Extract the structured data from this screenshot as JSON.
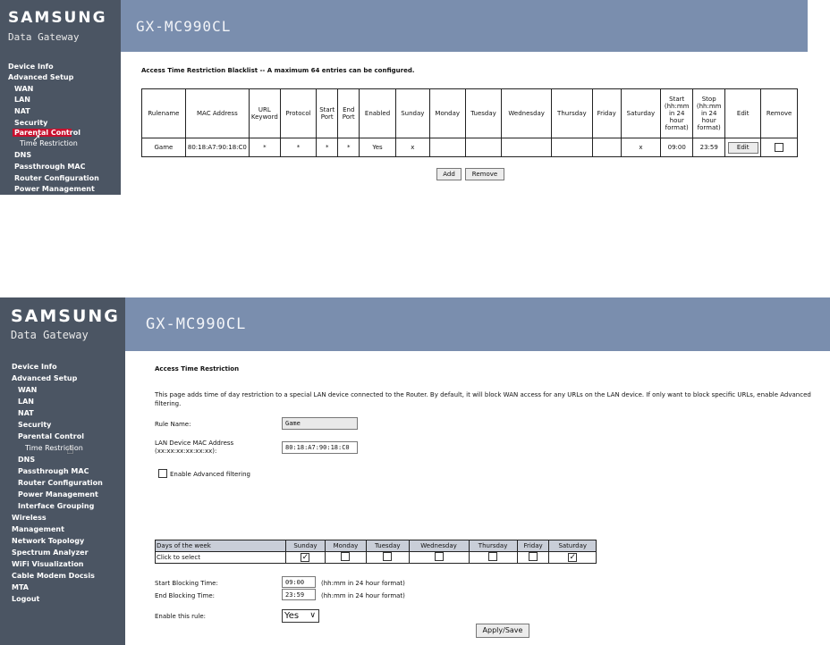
{
  "brand": {
    "name": "SAMSUNG",
    "subtitle": "Data Gateway",
    "model": "GX-MC990CL"
  },
  "shot1": {
    "sidebar": [
      "Device Info",
      "Advanced Setup",
      "WAN",
      "LAN",
      "NAT",
      "Security",
      "Parental Control",
      "Time Restriction",
      "DNS",
      "Passthrough MAC",
      "Router Configuration",
      "Power Management"
    ],
    "active_item": "Parental Control",
    "title": "Access Time Restriction Blacklist -- A maximum 64 entries can be configured.",
    "table": {
      "headers": [
        "Rulename",
        "MAC Address",
        "URL Keyword",
        "Protocol",
        "Start Port",
        "End Port",
        "Enabled",
        "Sunday",
        "Monday",
        "Tuesday",
        "Wednesday",
        "Thursday",
        "Friday",
        "Saturday",
        "Start (hh:mm in 24 hour format)",
        "Stop (hh:mm in 24 hour format)",
        "Edit",
        "Remove"
      ],
      "row": {
        "rulename": "Game",
        "mac": "80:18:A7:90:18:C0",
        "url": "*",
        "protocol": "*",
        "start_port": "*",
        "end_port": "*",
        "enabled": "Yes",
        "sunday": "x",
        "monday": "",
        "tuesday": "",
        "wednesday": "",
        "thursday": "",
        "friday": "",
        "saturday": "x",
        "start": "09:00",
        "stop": "23:59",
        "edit_label": "Edit",
        "remove_checked": false
      }
    },
    "buttons": {
      "add": "Add",
      "remove": "Remove"
    }
  },
  "shot2": {
    "sidebar": [
      "Device Info",
      "Advanced Setup",
      "WAN",
      "LAN",
      "NAT",
      "Security",
      "Parental Control",
      "Time Restriction",
      "DNS",
      "Passthrough MAC",
      "Router Configuration",
      "Power Management",
      "Interface Grouping",
      "Wireless",
      "Management",
      "Network Topology",
      "Spectrum Analyzer",
      "WiFi Visualization",
      "Cable Modem Docsis",
      "MTA",
      "Logout"
    ],
    "title": "Access Time Restriction",
    "description": "This page adds time of day restriction to a special LAN device connected to the Router. By default, it will block WAN access for any URLs on the LAN device. If only want to block specific URLs, enable Advanced filtering.",
    "rule_name_label": "Rule Name:",
    "rule_name_value": "Game",
    "mac_label_line1": "LAN Device MAC Address",
    "mac_label_line2": "(xx:xx:xx:xx:xx:xx):",
    "mac_value": "80:18:A7:90:18:C0",
    "advanced_filtering_label": "Enable Advanced filtering",
    "advanced_filtering_checked": false,
    "days_header": "Days of the week",
    "click_label": "Click to select",
    "days": [
      "Sunday",
      "Monday",
      "Tuesday",
      "Wednesday",
      "Thursday",
      "Friday",
      "Saturday"
    ],
    "days_checked": [
      true,
      false,
      false,
      false,
      false,
      false,
      true
    ],
    "start_label": "Start Blocking Time:",
    "start_value": "09:00",
    "end_label": "End Blocking Time:",
    "end_value": "23:59",
    "format_hint": "(hh:mm in 24 hour format)",
    "enable_rule_label": "Enable this rule:",
    "enable_rule_value": "Yes",
    "apply_label": "Apply/Save"
  }
}
